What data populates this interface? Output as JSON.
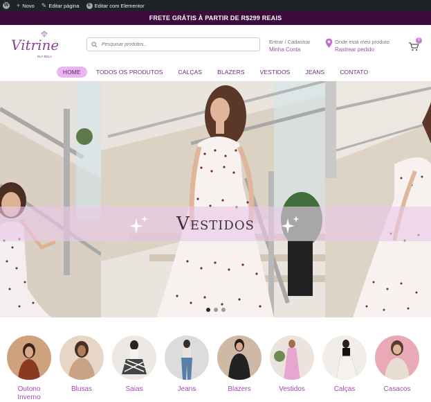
{
  "admin_bar": {
    "items": [
      {
        "icon": "plus-icon",
        "label": "Novo"
      },
      {
        "icon": "pencil-icon",
        "label": "Editar página"
      },
      {
        "icon": "elementor-icon",
        "label": "Editar com Elementor"
      }
    ]
  },
  "promo": {
    "text": "FRETE GRÁTIS À PARTIR DE R$299 REAIS"
  },
  "header": {
    "logo_text": "Vitrine",
    "logo_sub": "ELA BELA",
    "search_placeholder": "Pesquisar produtos...",
    "account_line1": "Entrar / Cadastrar",
    "account_line2": "Minha Conta",
    "track_line1": "Onde está meu produto",
    "track_line2": "Rastrear pedido",
    "cart_count": "0"
  },
  "nav": {
    "items": [
      "HOME",
      "TODOS OS PRODUTOS",
      "CALÇAS",
      "BLAZERS",
      "VESTIDOS",
      "JEANS",
      "CONTATO"
    ],
    "active": "HOME"
  },
  "hero": {
    "title": "Vestidos",
    "active_dot": 1
  },
  "categories": [
    "Outono Inverno",
    "Blusas",
    "Saias",
    "Jeans",
    "Blazers",
    "Vestidos",
    "Calças",
    "Casacos"
  ],
  "colors": {
    "brand": "#3d0a3c",
    "accent": "#a24ab0",
    "nav_active": "#e9b7ee"
  }
}
